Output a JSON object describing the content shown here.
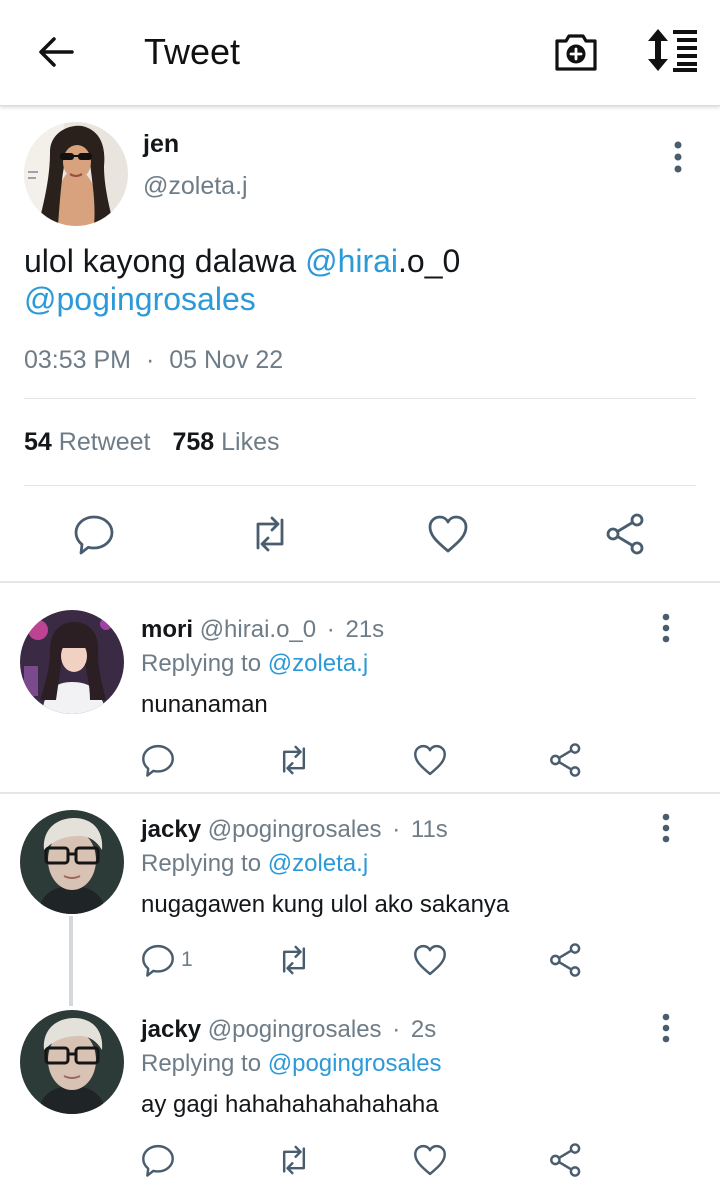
{
  "header": {
    "title": "Tweet",
    "back_icon": "arrow-left-icon",
    "camera_icon": "camera-add-icon",
    "sort_icon": "sort-list-icon"
  },
  "tweet": {
    "name": "jen",
    "handle": "@zoleta.j",
    "text_plain": "ulol kayong dalawa ",
    "mention_1": "@hirai",
    "text_mid": ".o_0",
    "mention_2": "@pogingrosales",
    "time": "03:53 PM",
    "separator": "·",
    "date": "05 Nov 22",
    "retweet_count": "54",
    "retweet_label": "Retweet",
    "likes_count": "758",
    "likes_label": "Likes"
  },
  "replies": [
    {
      "name": "mori",
      "handle": "@hirai.o_0",
      "separator": "·",
      "time": "21s",
      "replying_label": "Replying to",
      "replying_to": "@zoleta.j",
      "text": "nunanaman",
      "reply_count": ""
    },
    {
      "name": "jacky",
      "handle": "@pogingrosales",
      "separator": "·",
      "time": "11s",
      "replying_label": "Replying to",
      "replying_to": "@zoleta.j",
      "text": "nugagawen kung ulol ako sakanya",
      "reply_count": "1"
    },
    {
      "name": "jacky",
      "handle": "@pogingrosales",
      "separator": "·",
      "time": "2s",
      "replying_label": "Replying to",
      "replying_to": "@pogingrosales",
      "text": "ay gagi hahahahahahahaha",
      "reply_count": ""
    }
  ],
  "colors": {
    "link": "#2c9ad8",
    "secondary_text": "#6e7c87",
    "icon": "#4a5d6e"
  }
}
